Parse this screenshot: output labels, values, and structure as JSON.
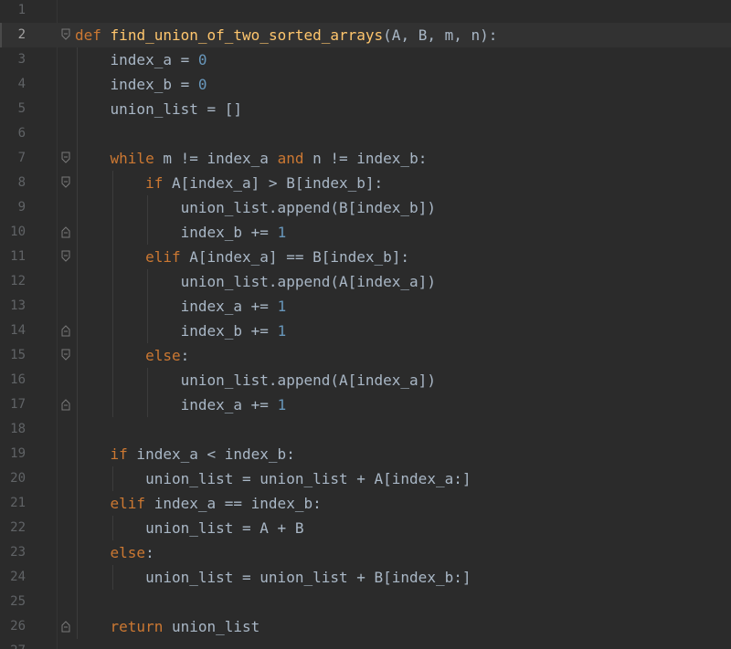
{
  "editor": {
    "language": "python",
    "current_line": 2,
    "colors": {
      "background": "#2b2b2b",
      "current_line": "#323232",
      "line_number": "#606366",
      "text": "#a9b7c6",
      "keyword": "#cc7832",
      "function_name": "#ffc66d",
      "number": "#6897bb"
    },
    "lines": [
      {
        "n": "1",
        "fold": "",
        "tokens": []
      },
      {
        "n": "2",
        "fold": "start",
        "tokens": [
          [
            "kw",
            "def"
          ],
          [
            "t",
            " "
          ],
          [
            "fn",
            "find_union_of_two_sorted_arrays"
          ],
          [
            "t",
            "(A, B, m, n):"
          ]
        ]
      },
      {
        "n": "3",
        "fold": "",
        "tokens": [
          [
            "t",
            "    index_a = "
          ],
          [
            "num",
            "0"
          ]
        ]
      },
      {
        "n": "4",
        "fold": "",
        "tokens": [
          [
            "t",
            "    index_b = "
          ],
          [
            "num",
            "0"
          ]
        ]
      },
      {
        "n": "5",
        "fold": "",
        "tokens": [
          [
            "t",
            "    union_list = []"
          ]
        ]
      },
      {
        "n": "6",
        "fold": "",
        "tokens": []
      },
      {
        "n": "7",
        "fold": "start",
        "tokens": [
          [
            "t",
            "    "
          ],
          [
            "kw",
            "while"
          ],
          [
            "t",
            " m != index_a "
          ],
          [
            "kw",
            "and"
          ],
          [
            "t",
            " n != index_b:"
          ]
        ]
      },
      {
        "n": "8",
        "fold": "start",
        "tokens": [
          [
            "t",
            "        "
          ],
          [
            "kw",
            "if"
          ],
          [
            "t",
            " A[index_a] > B[index_b]:"
          ]
        ]
      },
      {
        "n": "9",
        "fold": "",
        "tokens": [
          [
            "t",
            "            union_list.append(B[index_b])"
          ]
        ]
      },
      {
        "n": "10",
        "fold": "end",
        "tokens": [
          [
            "t",
            "            index_b += "
          ],
          [
            "num",
            "1"
          ]
        ]
      },
      {
        "n": "11",
        "fold": "start",
        "tokens": [
          [
            "t",
            "        "
          ],
          [
            "kw",
            "elif"
          ],
          [
            "t",
            " A[index_a] == B[index_b]:"
          ]
        ]
      },
      {
        "n": "12",
        "fold": "",
        "tokens": [
          [
            "t",
            "            union_list.append(A[index_a])"
          ]
        ]
      },
      {
        "n": "13",
        "fold": "",
        "tokens": [
          [
            "t",
            "            index_a += "
          ],
          [
            "num",
            "1"
          ]
        ]
      },
      {
        "n": "14",
        "fold": "end",
        "tokens": [
          [
            "t",
            "            index_b += "
          ],
          [
            "num",
            "1"
          ]
        ]
      },
      {
        "n": "15",
        "fold": "start",
        "tokens": [
          [
            "t",
            "        "
          ],
          [
            "kw",
            "else"
          ],
          [
            "t",
            ":"
          ]
        ]
      },
      {
        "n": "16",
        "fold": "",
        "tokens": [
          [
            "t",
            "            union_list.append(A[index_a])"
          ]
        ]
      },
      {
        "n": "17",
        "fold": "end",
        "tokens": [
          [
            "t",
            "            index_a += "
          ],
          [
            "num",
            "1"
          ]
        ]
      },
      {
        "n": "18",
        "fold": "",
        "tokens": []
      },
      {
        "n": "19",
        "fold": "",
        "tokens": [
          [
            "t",
            "    "
          ],
          [
            "kw",
            "if"
          ],
          [
            "t",
            " index_a < index_b:"
          ]
        ]
      },
      {
        "n": "20",
        "fold": "",
        "tokens": [
          [
            "t",
            "        union_list = union_list + A[index_a:]"
          ]
        ]
      },
      {
        "n": "21",
        "fold": "",
        "tokens": [
          [
            "t",
            "    "
          ],
          [
            "kw",
            "elif"
          ],
          [
            "t",
            " index_a == index_b:"
          ]
        ]
      },
      {
        "n": "22",
        "fold": "",
        "tokens": [
          [
            "t",
            "        union_list = A + B"
          ]
        ]
      },
      {
        "n": "23",
        "fold": "",
        "tokens": [
          [
            "t",
            "    "
          ],
          [
            "kw",
            "else"
          ],
          [
            "t",
            ":"
          ]
        ]
      },
      {
        "n": "24",
        "fold": "",
        "tokens": [
          [
            "t",
            "        union_list = union_list + B[index_b:]"
          ]
        ]
      },
      {
        "n": "25",
        "fold": "",
        "tokens": []
      },
      {
        "n": "26",
        "fold": "end",
        "tokens": [
          [
            "t",
            "    "
          ],
          [
            "kw",
            "return"
          ],
          [
            "t",
            " union_list"
          ]
        ]
      },
      {
        "n": "27",
        "fold": "",
        "tokens": []
      }
    ]
  }
}
